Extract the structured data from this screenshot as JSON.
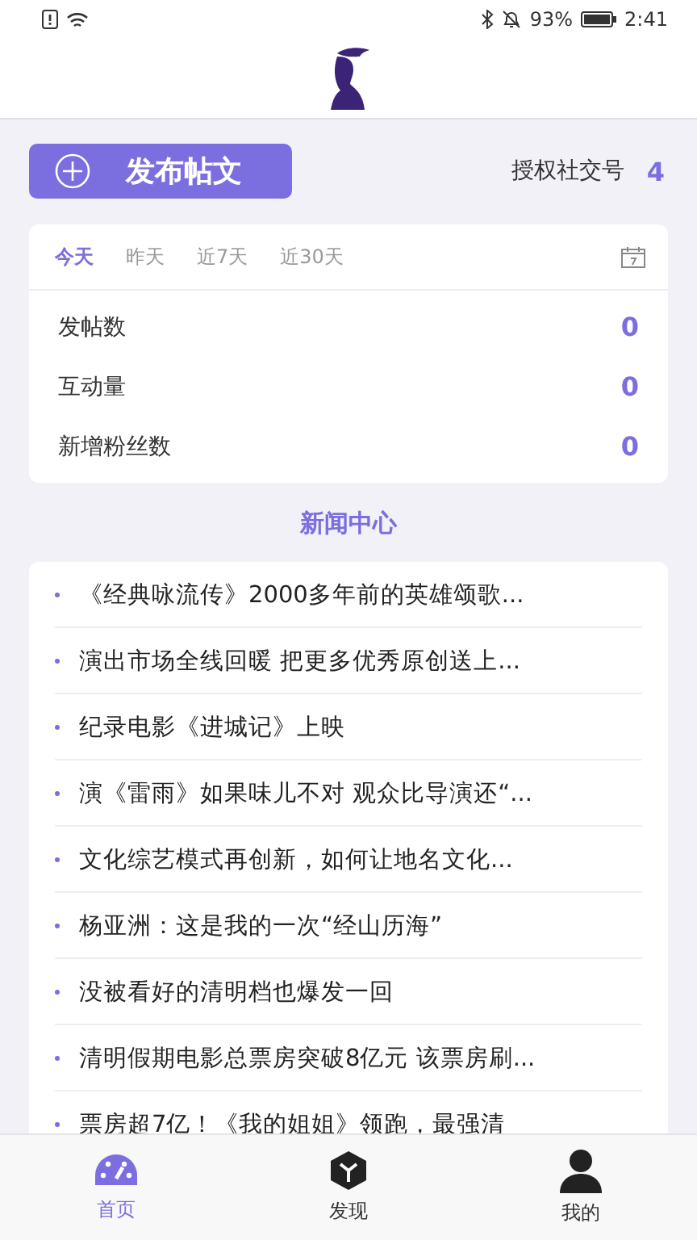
{
  "status_bar": {
    "battery": "93%",
    "time": "2:41"
  },
  "publish_button": {
    "label": "发布帖文"
  },
  "accounts": {
    "label": "授权社交号",
    "count": "4"
  },
  "stats": {
    "tabs": [
      {
        "label": "今天",
        "selected": true
      },
      {
        "label": "昨天",
        "selected": false
      },
      {
        "label": "近7天",
        "selected": false
      },
      {
        "label": "近30天",
        "selected": false
      }
    ],
    "rows": [
      {
        "label": "发帖数",
        "value": "0"
      },
      {
        "label": "互动量",
        "value": "0"
      },
      {
        "label": "新增粉丝数",
        "value": "0"
      }
    ]
  },
  "news": {
    "title": "新闻中心",
    "items": [
      "《经典咏流传》2000多年前的英雄颂歌...",
      "演出市场全线回暖 把更多优秀原创送上...",
      "纪录电影《进城记》上映",
      "演《雷雨》如果味儿不对 观众比导演还“...",
      "文化综艺模式再创新，如何让地名文化...",
      "杨亚洲：这是我的一次“经山历海”",
      "没被看好的清明档也爆发一回",
      "清明假期电影总票房突破8亿元 该票房刷...",
      "票房超7亿！《我的姐姐》领跑，最强清"
    ]
  },
  "tab_bar": [
    {
      "label": "首页",
      "kind": "dashboard",
      "selected": true
    },
    {
      "label": "发现",
      "kind": "cube",
      "selected": false
    },
    {
      "label": "我的",
      "kind": "person",
      "selected": false
    }
  ]
}
